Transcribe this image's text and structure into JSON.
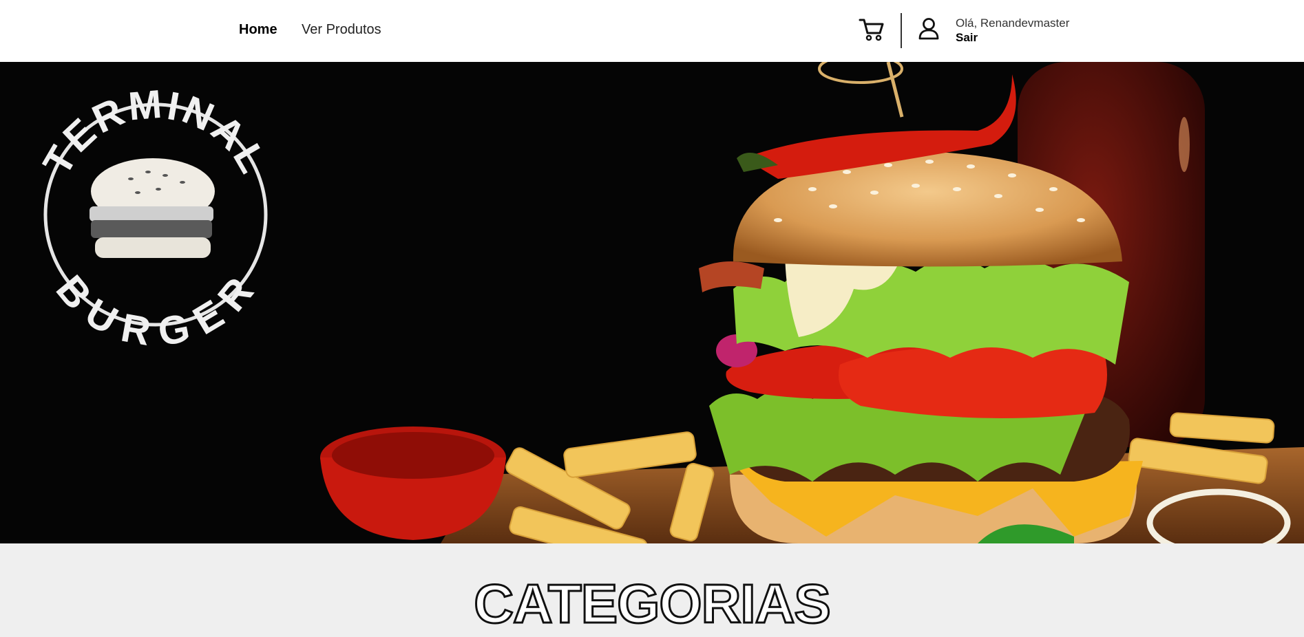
{
  "nav": {
    "home_label": "Home",
    "products_label": "Ver Produtos"
  },
  "user": {
    "greeting": "Olá, Renandevmaster",
    "logout_label": "Sair"
  },
  "hero": {
    "logo_top_text": "TERMINAL",
    "logo_bottom_text": "BURGER"
  },
  "categories": {
    "title": "CATEGORIAS"
  },
  "icons": {
    "cart": "cart-icon",
    "user": "user-icon"
  },
  "colors": {
    "header_bg": "#ffffff",
    "hero_bg": "#050505",
    "section_bg": "#efefef",
    "tomato": "#d71e10",
    "lettuce": "#7cbf2a",
    "bun": "#d9a15c"
  }
}
